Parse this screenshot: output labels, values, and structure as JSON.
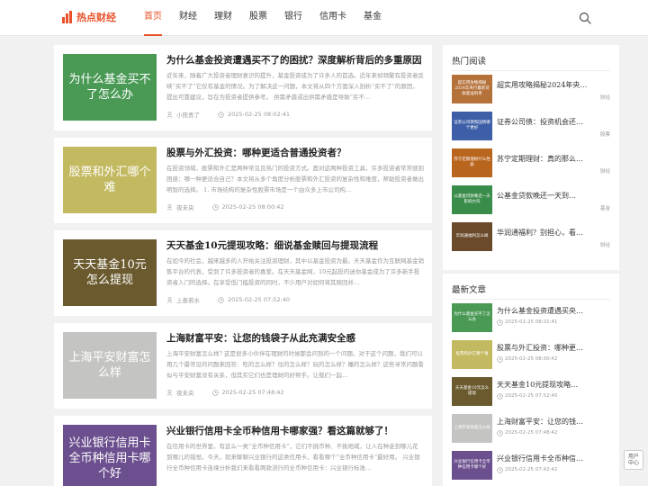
{
  "site": {
    "logo_text": "热点财经",
    "accent": "#e8512a"
  },
  "nav": [
    {
      "label": "首页",
      "active": true
    },
    {
      "label": "财经"
    },
    {
      "label": "理财"
    },
    {
      "label": "股票"
    },
    {
      "label": "银行"
    },
    {
      "label": "信用卡"
    },
    {
      "label": "基金"
    }
  ],
  "articles": [
    {
      "thumb_text": "为什么基金买不了怎么办",
      "thumb_bg": "#4a9a56",
      "thumb_fg": "#ffffff",
      "title": "为什么基金投资遭遇买不了的困扰？深度解析背后的多重原因",
      "excerpt": "近年来，随着广大投资者理财意识的提升，基金投资成为了许多人的首选。近年来却频繁有投资者反映“买不了”它仅有基金的情况。为了解决这一问题，本文将从四个方面深入剖析“买不了”的原因，提出可靠建议，旨在为投资者提供参考。 供需矛盾或出供需矛盾是导致“买不…",
      "author": "小熊丢了",
      "date": "2025-02-25 08:02:41"
    },
    {
      "thumb_text": "股票和外汇哪个难",
      "thumb_bg": "#c3b960",
      "thumb_fg": "#ffffff",
      "title": "股票与外汇投资：哪种更适合普通投资者？",
      "excerpt": "在投资领域，股票和外汇是两种常见且热门的投资方式。面对这两种投资工具，许多投资者常常感到困惑：哪一种更适合自己？本文将从多个角度分析股票和外汇投资的复杂性和难度，帮助投资者做出明智的选择。 1. 市场结构的复杂性股票市场是一个由众多上市公司构…",
      "author": "夜未央",
      "date": "2025-02-25 08:00:42"
    },
    {
      "thumb_text": "天天基金10元怎么提现",
      "thumb_bg": "#6a5a2e",
      "thumb_fg": "#ffffff",
      "title": "天天基金10元提现攻略：细说基金赎回与提现流程",
      "excerpt": "在如今的社会，越来越多的人开始关注投资理财，其中以基金投资为最。天天基金作为互联网基金销售平台的代表，受到了许多投资者的喜爱。在天天基金网，10元起投的迷你基金成为了许多新手投资者入门的选择。在享受低门槛投资的同时，不少用户对如何将其赎回并…",
      "author": "上善若水",
      "date": "2025-02-25 07:52:40"
    },
    {
      "thumb_text": "上海平安财富怎么样",
      "thumb_bg": "#c4c4c2",
      "thumb_fg": "#ffffff",
      "title": "上海财富平安：让您的钱袋子从此充满安全感",
      "excerpt": "上海平安财富怎么样? 这是很多小伙伴在理财的时候都会问到的一个问题。对于这个问题，我们可以用几个最常见的问题来回答：吃的怎么样？住的怎么样？玩的怎么样？睡的怎么样？这些寻常问题看似与平安财富没有关系，但其实它们也是理财的好帮手。让我们一起…",
      "author": "夜未央",
      "date": "2025-02-25 07:48:42"
    },
    {
      "thumb_text": "兴业银行信用卡 全币种信用卡哪个好",
      "thumb_bg": "#6b4f8e",
      "thumb_fg": "#ffffff",
      "title": "兴业银行信用卡全币种信用卡哪家强？看这篇就够了！",
      "excerpt": "在信用卡的世界里，有这么一类“全币种信用卡”，它们不挑币种、不挑地域，让人在种走到哪儿花到哪儿的错觉。今天，就来聊聊兴业银行的这类信用卡，看看哪个“全币种信用卡”最好用。 兴业银行全币种信用卡连境分析我们来看看两款流行的全币种信用卡：兴业银行标准…",
      "author": "",
      "date": ""
    }
  ],
  "sidebar": {
    "hot_title": "热门阅读",
    "hot": [
      {
        "thumb_text": "超实用攻略揭秘2024年央行最新贷款基准利率",
        "thumb_bg": "#b5713a",
        "title": "超实用攻略揭秘2024年央…",
        "category": "财经"
      },
      {
        "thumb_text": "证券公司债和国债哪个更好",
        "thumb_bg": "#3e5fa8",
        "title": "证券公司债：投资机会还…",
        "category": "股票"
      },
      {
        "thumb_text": "苏宁定期理财什么性质",
        "thumb_bg": "#b8651e",
        "title": "苏宁定期理财：真的那么…",
        "category": "财经"
      },
      {
        "thumb_text": "公基金贷款晚还一天影响大吗",
        "thumb_bg": "#3a8c4a",
        "title": "公基金贷款晚还一天到…",
        "category": "基金"
      },
      {
        "thumb_text": "华润通福利怎么样",
        "thumb_bg": "#6a4a2a",
        "title": "华润通福利？别担心，看…",
        "category": "财经"
      }
    ],
    "new_title": "最新文章",
    "new": [
      {
        "thumb_text": "为什么基金买不了怎么办",
        "thumb_bg": "#4a9a56",
        "title": "为什么基金投资遭遇买央…",
        "date": "2025-02-25 08:02:41"
      },
      {
        "thumb_text": "股票和外汇哪个难",
        "thumb_bg": "#c3b960",
        "title": "股票与外汇投资：哪种更…",
        "date": "2025-02-25 08:00:42"
      },
      {
        "thumb_text": "天天基金10元怎么提现",
        "thumb_bg": "#6a5a2e",
        "title": "天天基金10元提现攻略…",
        "date": "2025-02-25 07:52:40"
      },
      {
        "thumb_text": "上海平安财富怎么样",
        "thumb_bg": "#c4c4c2",
        "title": "上海财富平安：让您的钱…",
        "date": "2025-02-25 07:48:42"
      },
      {
        "thumb_text": "兴业银行信用卡全币种信用卡哪个好",
        "thumb_bg": "#6b4f8e",
        "title": "兴业银行信用卡全币种信…",
        "date": "2025-02-25 07:42:42"
      }
    ]
  },
  "float_button": {
    "label": "用户\n中心"
  }
}
